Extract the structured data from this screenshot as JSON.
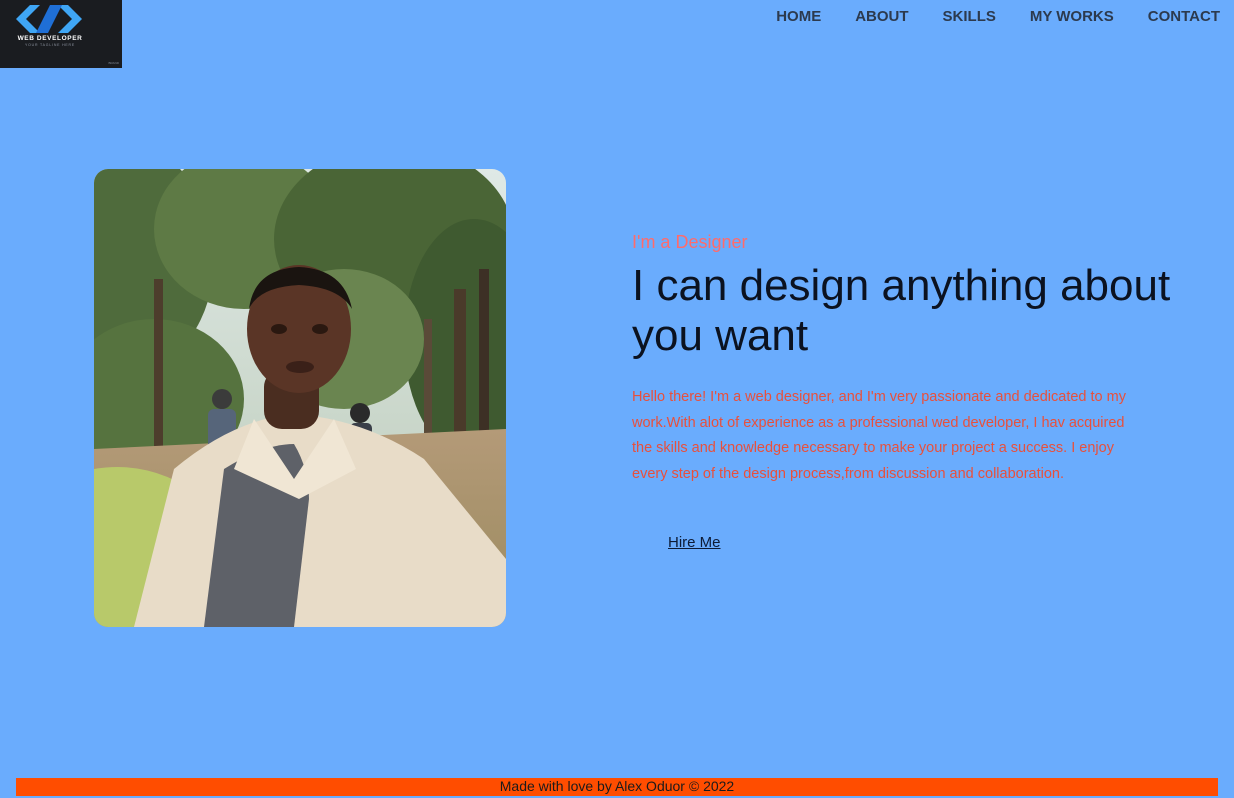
{
  "logo": {
    "title": "WEB DEVELOPER",
    "tagline": "YOUR TAGLINE HERE",
    "mark": "BRAND"
  },
  "nav": {
    "items": [
      {
        "label": "HOME"
      },
      {
        "label": "ABOUT"
      },
      {
        "label": "SKILLS"
      },
      {
        "label": "MY WORKS"
      },
      {
        "label": "CONTACT"
      }
    ]
  },
  "hero": {
    "subtitle": "I'm a Designer",
    "headline": "I can design anything about you want",
    "intro": "Hello there! I'm a web designer, and I'm very passionate and dedicated to my work.With alot of experience as a professional wed developer, I hav acquired the skills and knowledge necessary to make your project a success. I enjoy every step of the design process,from discussion and collaboration.",
    "cta": "Hire Me"
  },
  "footer": {
    "text": "Made with love by Alex Oduor © 2022"
  },
  "colors": {
    "background": "#6aacfd",
    "subtitle": "#ff6b6b",
    "intro": "#e8503c",
    "footer_bar": "#ff4d00",
    "logo_bg": "#1a1c20",
    "logo_accent": "#3fa6f5"
  },
  "icons": {
    "logo": "code-brackets-icon"
  }
}
